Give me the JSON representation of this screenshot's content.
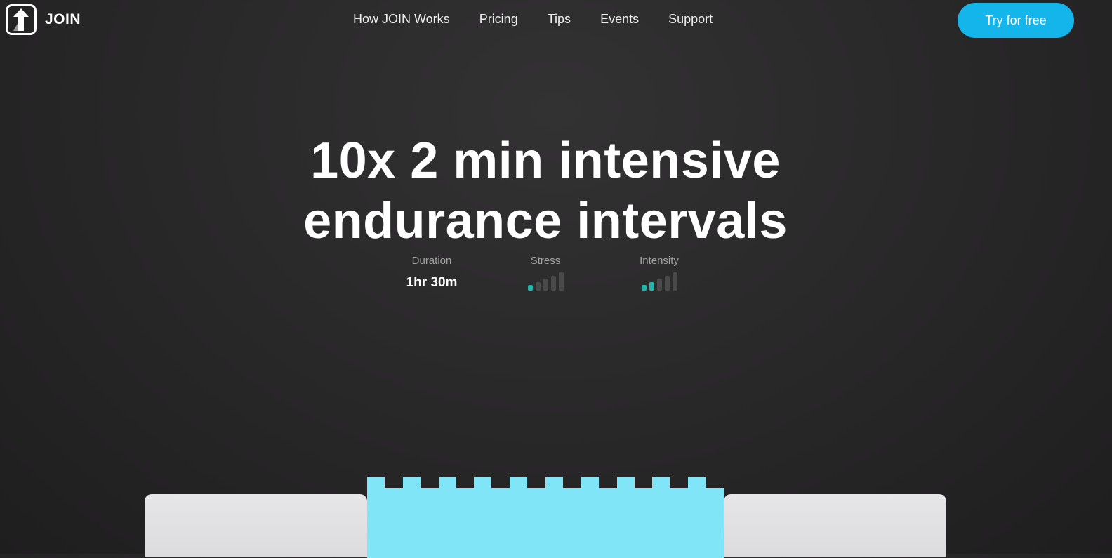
{
  "header": {
    "logo_text": "JOIN",
    "nav": [
      "How JOIN Works",
      "Pricing",
      "Tips",
      "Events",
      "Support"
    ],
    "cta_label": "Try for free",
    "cta_color": "#13b5ea"
  },
  "hero": {
    "title_line1": "10x 2 min intensive",
    "title_line2": "endurance intervals",
    "stats": {
      "duration_label": "Duration",
      "duration_value": "1hr 30m",
      "stress_label": "Stress",
      "stress_level": 1,
      "intensity_label": "Intensity",
      "intensity_level": 2,
      "level_max": 5,
      "active_color": "#26b5ad"
    }
  }
}
